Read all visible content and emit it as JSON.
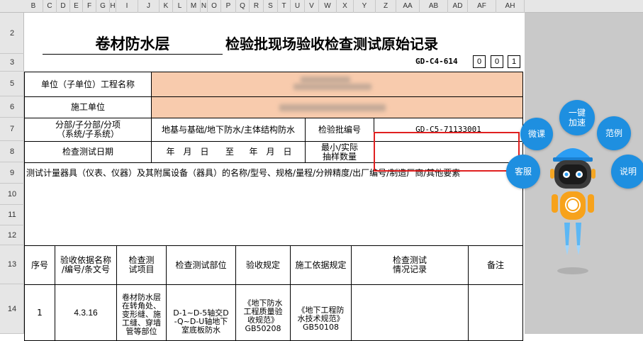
{
  "columns": [
    "B",
    "C",
    "D",
    "E",
    "F",
    "G",
    "H",
    "I",
    "J",
    "K",
    "L",
    "M",
    "N",
    "O",
    "P",
    "Q",
    "R",
    "S",
    "T",
    "U",
    "V",
    "W",
    "X",
    "Y",
    "Z",
    "AA",
    "AB",
    "AD",
    "AF",
    "AH"
  ],
  "rows": [
    "2",
    "3",
    "5",
    "6",
    "7",
    "8",
    "9",
    "10",
    "11",
    "12",
    "13",
    "14"
  ],
  "title": {
    "left": "卷材防水层",
    "right": "检验批现场验收检查测试原始记录"
  },
  "code": {
    "label": "GD-C4-614",
    "digits": [
      "0",
      "0",
      "1"
    ]
  },
  "form": {
    "unit_project_label": "单位（子单位）工程名称",
    "construction_unit_label": "施工单位",
    "division_label": "分部/子分部/分项\n（系统/子系统）",
    "division_value": "地基与基础/地下防水/主体结构防水",
    "batch_no_label": "检验批编号",
    "batch_no_value": "GD-C5-71133001",
    "date_label": "检查测试日期",
    "date_from": "年　月　日",
    "date_to_label": "至",
    "date_to": "年　月　日",
    "sample_label": "最小/实际\n抽样数量",
    "instrument_text": "测试计量器具（仪表、仪器）及其附属设备（器具）的名称/型号、规格/量程/分辨精度/出厂编号/制造厂商/其他要素"
  },
  "table": {
    "headers": [
      "序号",
      "验收依据名称\n/编号/条文号",
      "检查测\n试项目",
      "检查测试部位",
      "验收规定",
      "施工依据规定",
      "检查测试\n情况记录",
      "备注"
    ],
    "row1": {
      "no": "1",
      "clause": "4.3.16",
      "item": "卷材防水层\n在转角处、\n变形缝、施\n工缝、穿墙\n管等部位",
      "location": "D-1~D-5轴交D\n-Q~D-U轴地下\n室底板防水",
      "acceptance": "《地下防水\n工程质量验\n收规范》\nGB50208",
      "basis": "《地下工程防\n水技术规范》\nGB50108",
      "record": "",
      "remark": ""
    }
  },
  "widget": {
    "buttons": {
      "weike": "微课",
      "jiasu": "一键\n加速",
      "fanli": "范例",
      "kefu": "客服",
      "shuoming": "说明"
    }
  }
}
